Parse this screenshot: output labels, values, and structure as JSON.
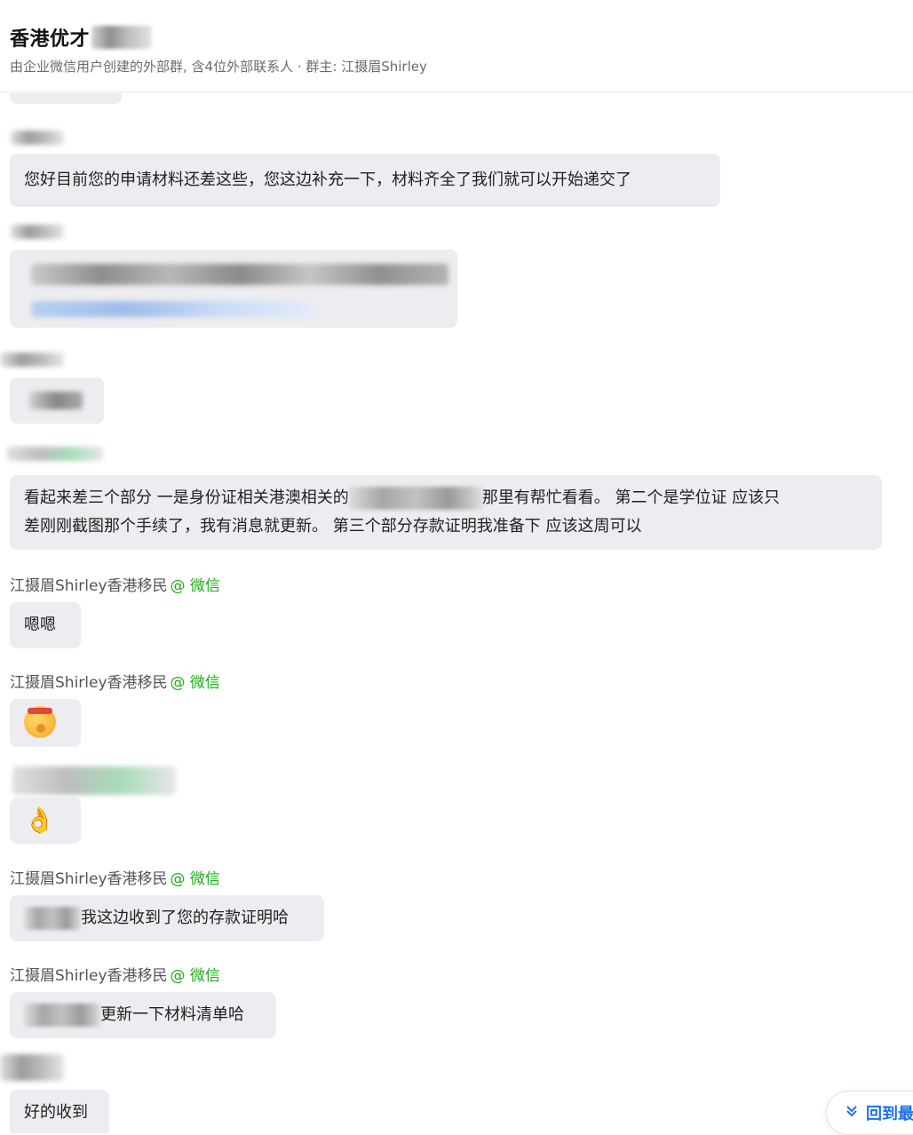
{
  "header": {
    "title": "香港优才",
    "subtitle": "由企业微信用户创建的外部群, 含4位外部联系人 · 群主: 江摄眉Shirley"
  },
  "messages": {
    "m1": "您好目前您的申请材料还差这些，您这边补充一下，材料齐全了我们就可以开始递交了",
    "m5_a": "看起来差三个部分 一是身份证相关港澳相关的",
    "m5_b": "那里有帮忙看看。 第二个是学位证 应该只",
    "m5_c": "差刚刚截图那个手续了，我有消息就更新。 第三个部分存款证明我准备下 应该这周可以",
    "m6": "嗯嗯",
    "m9": "我这边收到了您的存款证明哈",
    "m10": "更新一下材料清单哈",
    "m11": "好的收到"
  },
  "senders": {
    "agent_name": "江摄眉Shirley香港移民",
    "agent_source": "@ 微信"
  },
  "emoji": {
    "salute": "salute-face-emoji",
    "ok": "👌"
  },
  "back_button": {
    "label": "回到最",
    "icon": "double-chevron-down-icon"
  },
  "colors": {
    "bubble": "#ededf1",
    "wechat_green": "#1aad19",
    "link_blue": "#1f6fe5"
  }
}
